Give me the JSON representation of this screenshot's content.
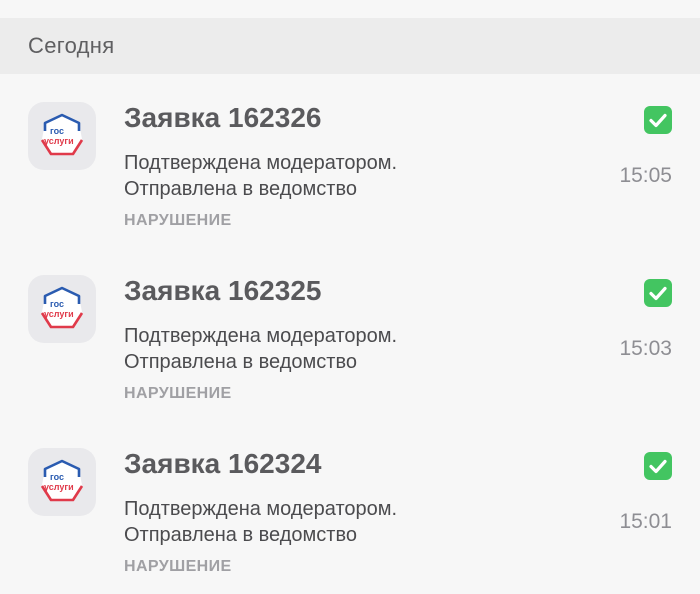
{
  "section": {
    "title": "Сегодня"
  },
  "app": {
    "icon_name": "gosuslugi-logo-icon",
    "logo_line1": "гос",
    "logo_line2": "услуги",
    "accent_red": "#e03a4a",
    "accent_blue": "#2a5bb0"
  },
  "colors": {
    "check_green": "#43c561",
    "header_bg": "#ececec",
    "page_bg": "#f7f7f7"
  },
  "notifications": [
    {
      "title": "Заявка 162326",
      "line1": "Подтверждена модератором.",
      "line2": "Отправлена в ведомство",
      "category": "НАРУШЕНИЕ",
      "time": "15:05",
      "checked": true
    },
    {
      "title": "Заявка 162325",
      "line1": "Подтверждена модератором.",
      "line2": "Отправлена в ведомство",
      "category": "НАРУШЕНИЕ",
      "time": "15:03",
      "checked": true
    },
    {
      "title": "Заявка 162324",
      "line1": "Подтверждена модератором.",
      "line2": "Отправлена в ведомство",
      "category": "НАРУШЕНИЕ",
      "time": "15:01",
      "checked": true
    }
  ]
}
